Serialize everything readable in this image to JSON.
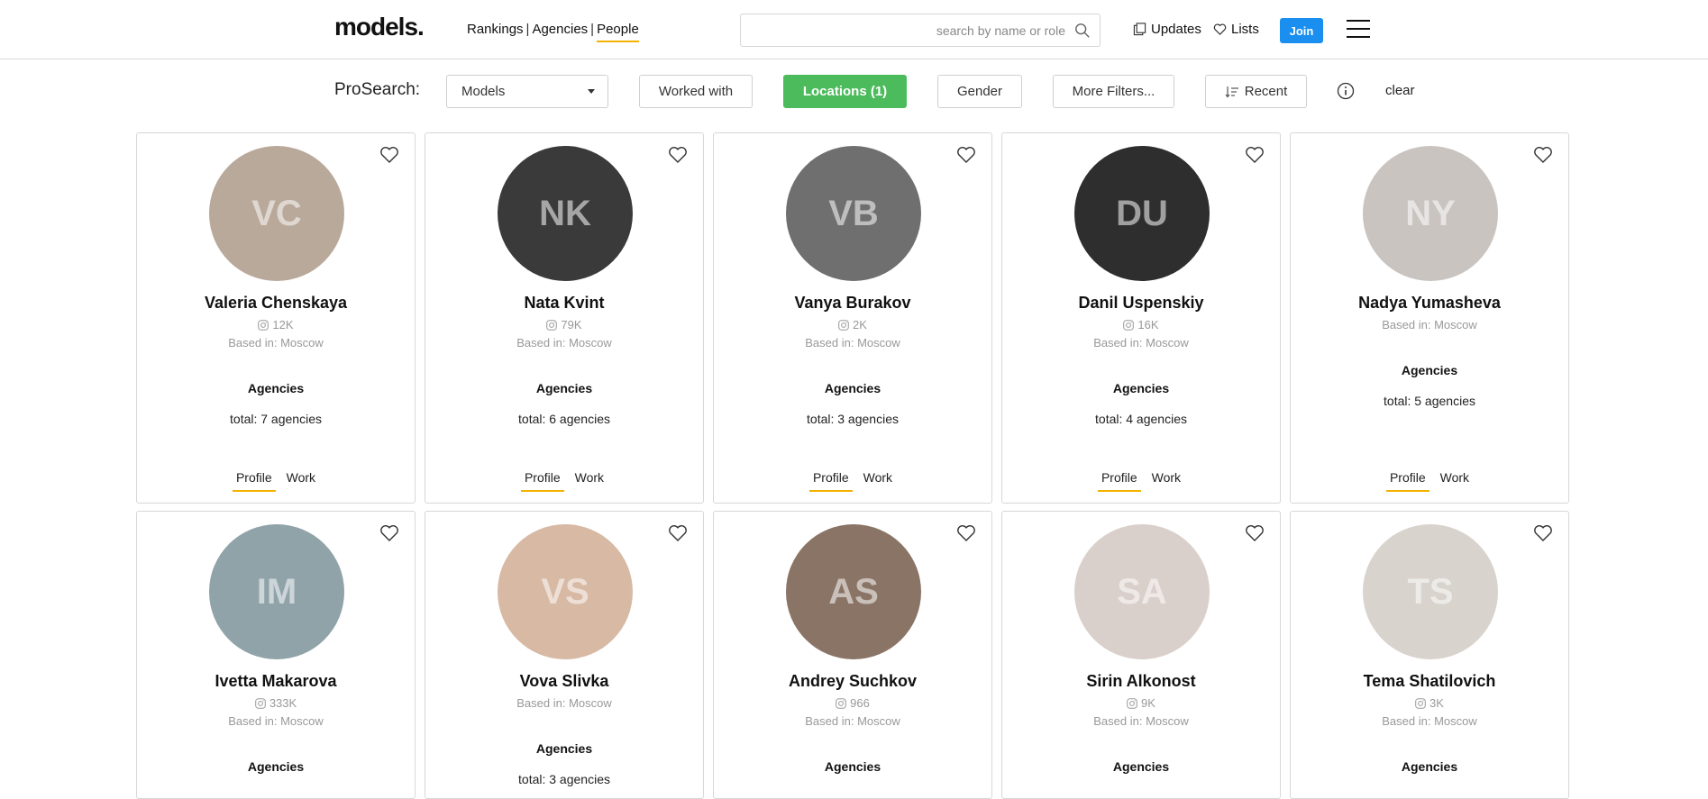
{
  "header": {
    "logo": "models.",
    "nav": [
      {
        "label": "Rankings",
        "active": false
      },
      {
        "label": "Agencies",
        "active": false
      },
      {
        "label": "People",
        "active": true
      }
    ],
    "nav_separator": "|",
    "search": {
      "placeholder": "search by name or role",
      "value": ""
    },
    "updates_label": "Updates",
    "lists_label": "Lists",
    "join_label": "Join",
    "colors": {
      "accent_underline": "#f2b300",
      "join_blue": "#1a8ff0"
    }
  },
  "filters": {
    "label": "ProSearch:",
    "type_select": {
      "selected": "Models"
    },
    "worked_with": "Worked with",
    "locations": "Locations (1)",
    "gender": "Gender",
    "more_filters": "More Filters...",
    "sort": "Recent",
    "clear": "clear",
    "colors": {
      "locations_active": "#4cbb5c"
    }
  },
  "card_labels": {
    "agencies_heading": "Agencies",
    "profile_tab": "Profile",
    "work_tab": "Work"
  },
  "people": [
    {
      "name": "Valeria Chenskaya",
      "followers": "12K",
      "based": "Based in: Moscow",
      "agencies_total": "total: 7 agencies",
      "avatar_color": "#b9a99a"
    },
    {
      "name": "Nata Kvint",
      "followers": "79K",
      "based": "Based in: Moscow",
      "agencies_total": "total: 6 agencies",
      "avatar_color": "#3a3a3a"
    },
    {
      "name": "Vanya Burakov",
      "followers": "2K",
      "based": "Based in: Moscow",
      "agencies_total": "total: 3 agencies",
      "avatar_color": "#6f6f6f"
    },
    {
      "name": "Danil Uspenskiy",
      "followers": "16K",
      "based": "Based in: Moscow",
      "agencies_total": "total: 4 agencies",
      "avatar_color": "#2e2e2e"
    },
    {
      "name": "Nadya Yumasheva",
      "followers": "",
      "based": "Based in: Moscow",
      "agencies_total": "total: 5 agencies",
      "avatar_color": "#c9c4c0"
    },
    {
      "name": "Ivetta Makarova",
      "followers": "333K",
      "based": "Based in: Moscow",
      "agencies_total": "",
      "avatar_color": "#8fa3a8"
    },
    {
      "name": "Vova Slivka",
      "followers": "",
      "based": "Based in: Moscow",
      "agencies_total": "total: 3 agencies",
      "avatar_color": "#d7b9a4"
    },
    {
      "name": "Andrey Suchkov",
      "followers": "966",
      "based": "Based in: Moscow",
      "agencies_total": "",
      "avatar_color": "#8a7466"
    },
    {
      "name": "Sirin Alkonost",
      "followers": "9K",
      "based": "Based in: Moscow",
      "agencies_total": "",
      "avatar_color": "#d9cfcb"
    },
    {
      "name": "Tema Shatilovich",
      "followers": "3K",
      "based": "Based in: Moscow",
      "agencies_total": "",
      "avatar_color": "#d8d3cd"
    }
  ]
}
